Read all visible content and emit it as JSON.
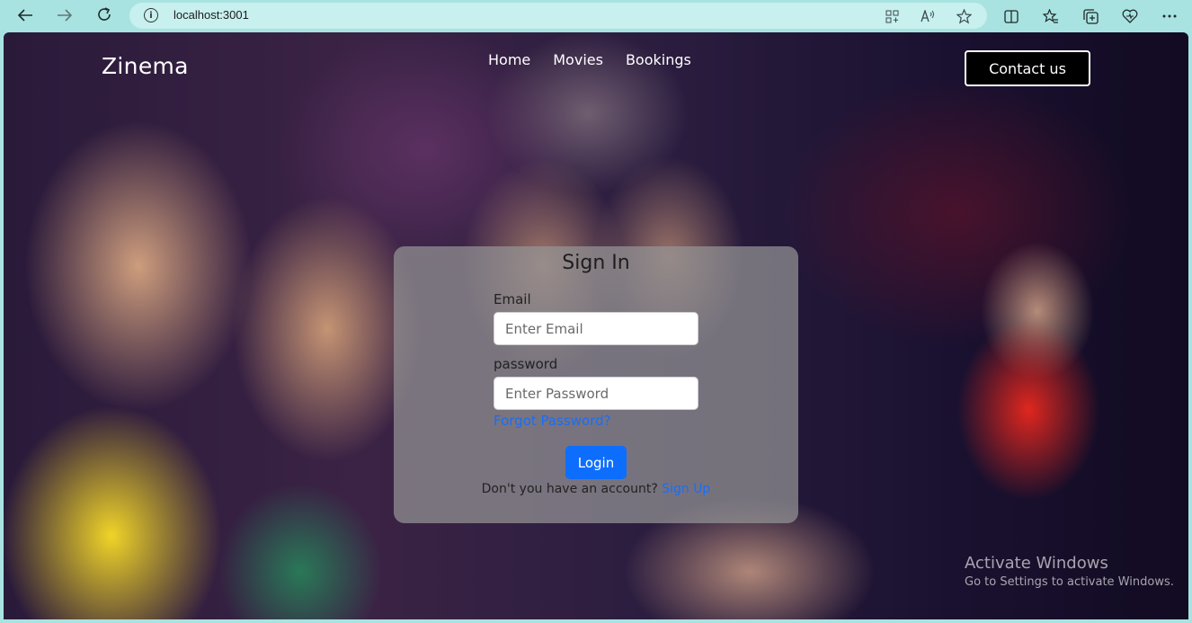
{
  "browser": {
    "url": "localhost:3001",
    "info_icon": "info-icon",
    "back_icon": "arrow-left-icon",
    "forward_icon": "arrow-right-icon",
    "refresh_icon": "refresh-icon",
    "address_icons": [
      "apps-icon",
      "read-aloud-icon",
      "favorite-star-icon"
    ],
    "toolbar_icons": [
      "split-screen-icon",
      "favorites-icon",
      "collections-icon",
      "performance-icon",
      "more-icon"
    ]
  },
  "site": {
    "brand": "Zinema",
    "nav": [
      "Home",
      "Movies",
      "Bookings"
    ],
    "contact_label": "Contact us"
  },
  "signin": {
    "title": "Sign In",
    "email_label": "Email",
    "email_placeholder": "Enter Email",
    "password_label": "password",
    "password_placeholder": "Enter Password",
    "forgot_label": "Forgot Password?",
    "login_label": "Login",
    "signup_prompt": "Don't you have an account?",
    "signup_link": "Sign Up"
  },
  "watermark": {
    "title": "Activate Windows",
    "subtitle": "Go to Settings to activate Windows."
  },
  "colors": {
    "chrome": "#a8e3e1",
    "address_bar": "#c7f0ee",
    "primary_button": "#0d6efd",
    "link": "#1a6ef5"
  }
}
